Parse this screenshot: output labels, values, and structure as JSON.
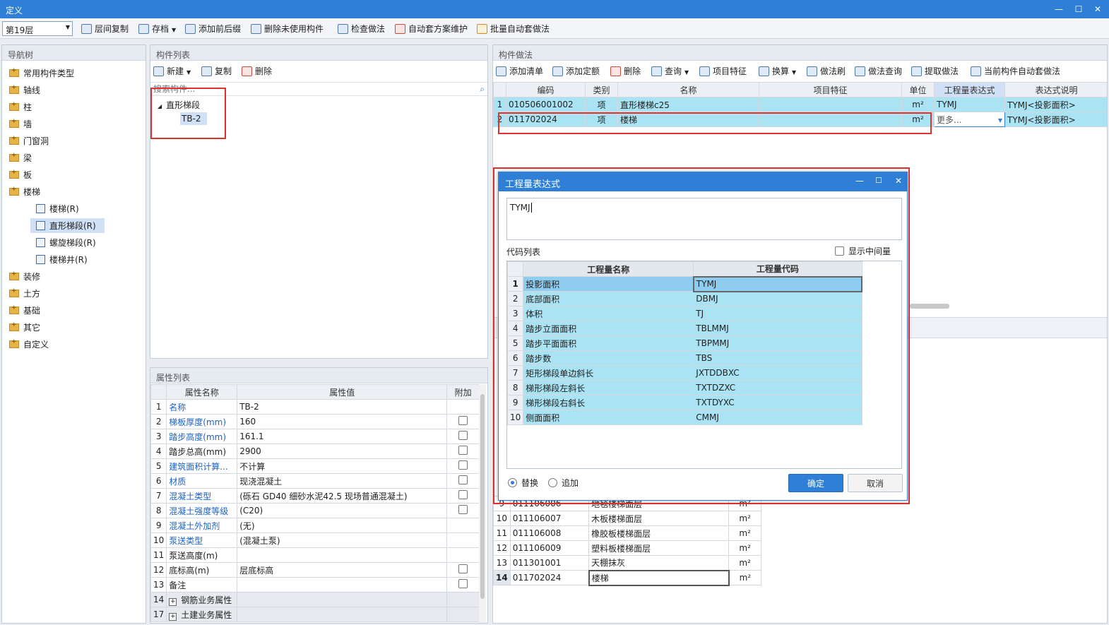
{
  "window": {
    "title": "定义"
  },
  "toolbar": {
    "floor": "第19层",
    "buttons": [
      "层间复制",
      "存档",
      "添加前后缀",
      "删除未使用构件",
      "检查做法",
      "自动套方案维护",
      "批量自动套做法"
    ]
  },
  "nav": {
    "title": "导航树",
    "items": [
      "常用构件类型",
      "轴线",
      "柱",
      "墙",
      "门窗洞",
      "梁",
      "板",
      "楼梯",
      "装修",
      "土方",
      "基础",
      "其它",
      "自定义"
    ],
    "stair_children": [
      "楼梯(R)",
      "直形梯段(R)",
      "螺旋梯段(R)",
      "楼梯井(R)"
    ]
  },
  "components": {
    "title": "构件列表",
    "new": "新建",
    "copy": "复制",
    "delete": "删除",
    "search_placeholder": "搜索构件...",
    "group": "直形梯段",
    "item": "TB-2"
  },
  "props": {
    "title": "属性列表",
    "headers": [
      "属性名称",
      "属性值",
      "附加"
    ],
    "rows": [
      {
        "n": "1",
        "name": "名称",
        "val": "TB-2",
        "link": true,
        "cb": false
      },
      {
        "n": "2",
        "name": "梯板厚度(mm)",
        "val": "160",
        "link": true,
        "cb": true
      },
      {
        "n": "3",
        "name": "踏步高度(mm)",
        "val": "161.1",
        "link": true,
        "cb": true
      },
      {
        "n": "4",
        "name": "踏步总高(mm)",
        "val": "2900",
        "link": false,
        "cb": true
      },
      {
        "n": "5",
        "name": "建筑面积计算...",
        "val": "不计算",
        "link": true,
        "cb": true
      },
      {
        "n": "6",
        "name": "材质",
        "val": "现浇混凝土",
        "link": true,
        "cb": true
      },
      {
        "n": "7",
        "name": "混凝土类型",
        "val": "(砾石 GD40 细砂水泥42.5 现场普通混凝土)",
        "link": true,
        "cb": true
      },
      {
        "n": "8",
        "name": "混凝土强度等级",
        "val": "(C20)",
        "link": true,
        "cb": true
      },
      {
        "n": "9",
        "name": "混凝土外加剂",
        "val": "(无)",
        "link": true,
        "cb": false
      },
      {
        "n": "10",
        "name": "泵送类型",
        "val": "(混凝土泵)",
        "link": true,
        "cb": false
      },
      {
        "n": "11",
        "name": "泵送高度(m)",
        "val": "",
        "link": false,
        "cb": false
      },
      {
        "n": "12",
        "name": "底标高(m)",
        "val": "层底标高",
        "link": false,
        "cb": true
      },
      {
        "n": "13",
        "name": "备注",
        "val": "",
        "link": false,
        "cb": true
      },
      {
        "n": "14",
        "name": "钢筋业务属性",
        "val": "",
        "link": false,
        "cb": false,
        "group": true
      },
      {
        "n": "17",
        "name": "土建业务属性",
        "val": "",
        "link": false,
        "cb": false,
        "group": true
      }
    ]
  },
  "methods": {
    "title": "构件做法",
    "buttons": [
      "添加清单",
      "添加定额",
      "删除",
      "查询",
      "项目特征",
      "换算",
      "做法刷",
      "做法查询",
      "提取做法",
      "当前构件自动套做法"
    ],
    "headers": [
      "编码",
      "类别",
      "名称",
      "项目特征",
      "单位",
      "工程量表达式",
      "表达式说明"
    ],
    "rows": [
      {
        "n": "1",
        "code": "010506001002",
        "type": "项",
        "name": "直形楼梯c25",
        "feat": "",
        "unit": "m²",
        "expr": "TYMJ",
        "desc": "TYMJ<投影面积>"
      },
      {
        "n": "2",
        "code": "011702024",
        "type": "项",
        "name": "楼梯",
        "feat": "",
        "unit": "m²",
        "expr": "更多...",
        "desc": "TYMJ<投影面积>"
      }
    ]
  },
  "lower": {
    "rows": [
      {
        "n": "9",
        "code": "011106006",
        "name": "地毯楼梯面层",
        "unit": "m²"
      },
      {
        "n": "10",
        "code": "011106007",
        "name": "木板楼梯面层",
        "unit": "m²"
      },
      {
        "n": "11",
        "code": "011106008",
        "name": "橡胶板楼梯面层",
        "unit": "m²"
      },
      {
        "n": "12",
        "code": "011106009",
        "name": "塑料板楼梯面层",
        "unit": "m²"
      },
      {
        "n": "13",
        "code": "011301001",
        "name": "天棚抹灰",
        "unit": "m²"
      },
      {
        "n": "14",
        "code": "011702024",
        "name": "楼梯",
        "unit": "m²"
      }
    ]
  },
  "dialog": {
    "title": "工程量表达式",
    "expr": "TYMJ",
    "code_list": "代码列表",
    "show_mid": "显示中间量",
    "headers": [
      "工程量名称",
      "工程量代码"
    ],
    "rows": [
      {
        "n": "1",
        "name": "投影面积",
        "code": "TYMJ"
      },
      {
        "n": "2",
        "name": "底部面积",
        "code": "DBMJ"
      },
      {
        "n": "3",
        "name": "体积",
        "code": "TJ"
      },
      {
        "n": "4",
        "name": "踏步立面面积",
        "code": "TBLMMJ"
      },
      {
        "n": "5",
        "name": "踏步平面面积",
        "code": "TBPMMJ"
      },
      {
        "n": "6",
        "name": "踏步数",
        "code": "TBS"
      },
      {
        "n": "7",
        "name": "矩形梯段单边斜长",
        "code": "JXTDDBXC"
      },
      {
        "n": "8",
        "name": "梯形梯段左斜长",
        "code": "TXTDZXC"
      },
      {
        "n": "9",
        "name": "梯形梯段右斜长",
        "code": "TXTDYXC"
      },
      {
        "n": "10",
        "name": "侧面面积",
        "code": "CMMJ"
      }
    ],
    "replace": "替换",
    "append": "追加",
    "ok": "确定",
    "cancel": "取消"
  },
  "colors": {
    "titlebar": "#2f7fd6",
    "highlight": "#a9e3f4",
    "annotation": "#e03131"
  }
}
